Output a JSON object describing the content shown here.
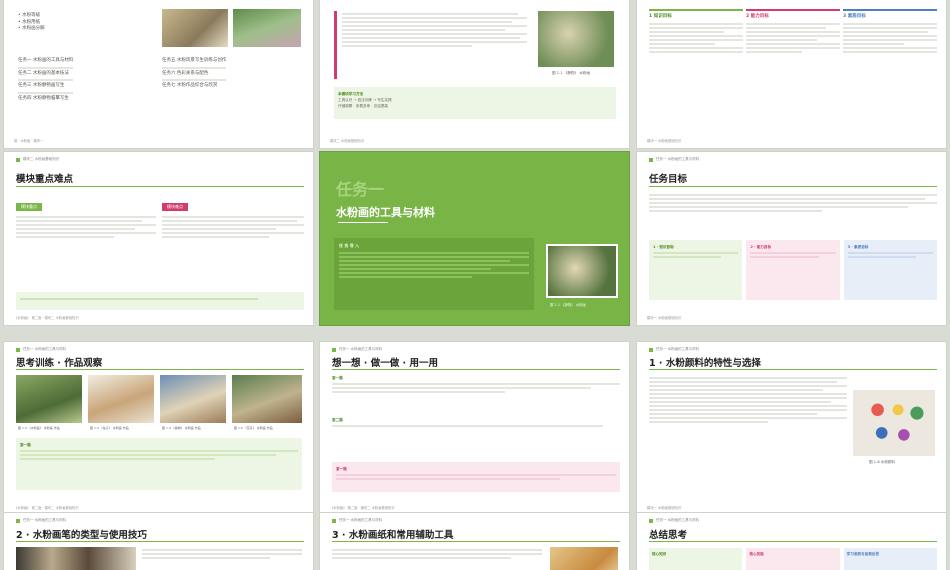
{
  "colors": {
    "accent": "#7ab648",
    "red": "#d23b6b",
    "blue": "#4f7fc0",
    "cover": "#79b447"
  },
  "p1": {
    "list": [
      "水粉等级",
      "水粉用纸",
      "水粉画分解"
    ],
    "tasks_left": [
      "任务一  水粉画的工具与材料",
      "任务二  水粉画的基本技法",
      "任务三  水粉静物画写生",
      "任务四  水粉静物临摹写生"
    ],
    "tasks_right": [
      "任务五  水粉风景写生训练与创作",
      "任务六  色彩关系与配色",
      "任务七  水粉作品综合与欣赏"
    ],
    "footer": "基 · 水粉画 · 模块一"
  },
  "p2": {
    "caption": "图 1-1 《静物》 水粉画",
    "methods_title": "本模块学习方法",
    "methods": [
      "工具认识 → 技法训练 → 写生实践",
      "仔细观察 · 多看多练 · 总结提高"
    ],
    "footer": "模块二  水粉画基础知识"
  },
  "p3": {
    "goals": [
      {
        "label": "1 知识目标",
        "color": "green"
      },
      {
        "label": "2 能力目标",
        "color": "red"
      },
      {
        "label": "3 素质目标",
        "color": "blue"
      }
    ],
    "footer": "模块一  水粉画基础知识"
  },
  "p4": {
    "header": "模块二  水粉画基础知识",
    "title": "模块重点难点",
    "key_label": "模块重点",
    "diff_label": "模块难点",
    "footer": "《水粉画》 第二版  ·  模块二 水粉画基础知识"
  },
  "p5": {
    "cover_title": "任务一",
    "cover_sub": "水粉画的工具与材料",
    "intro_label": "任 务 导 入",
    "caption": "图 1-1 《静物》 水粉画"
  },
  "p6": {
    "header": "任务一  水粉画的工具与材料",
    "title": "任务目标",
    "goals": [
      {
        "label": "1 · 知识目标",
        "color": "green"
      },
      {
        "label": "2 · 能力目标",
        "color": "red"
      },
      {
        "label": "3 · 素质目标",
        "color": "blue"
      }
    ],
    "footer": "模块一  水粉画基础知识"
  },
  "p7": {
    "header": "任务一  水粉画的工具与材料",
    "title": "思考训练 · 作品观察",
    "captions": [
      "图 1-2 《水粉画》 水粉画 作品",
      "图 1-3 《兔子》 水粉画 作品",
      "图 1-4 《静物》 水粉画 作品",
      "图 1-5 《花卉》 水粉画 作品"
    ],
    "note_label": "第一题",
    "footer": "《水粉画》 第二版  ·  模块二 水粉画基础知识"
  },
  "p8": {
    "header": "任务一  水粉画的工具与材料",
    "title": "想一想 · 做一做 · 用一用",
    "sections": [
      "第一题",
      "第二题",
      "第一题"
    ],
    "footer": "《水粉画》 第二版  ·  模块二 水粉画基础知识"
  },
  "p9": {
    "header": "任务一  水粉画的工具与材料",
    "title": "1 · 水粉颜料的特性与选择",
    "caption": "图 1-6 水粉颜料",
    "footer": "模块一  水粉画基础知识"
  },
  "p10": {
    "header": "任务一  水粉画的工具与材料",
    "title": "2 · 水粉画笔的类型与使用技巧"
  },
  "p11": {
    "header": "任务一  水粉画的工具与材料",
    "title": "3 · 水粉画纸和常用辅助工具"
  },
  "p12": {
    "header": "任务一  水粉画的工具与材料",
    "title": "总结思考",
    "boxes": [
      "核心知识",
      "核心技能",
      "学习收获与自我反思"
    ]
  }
}
